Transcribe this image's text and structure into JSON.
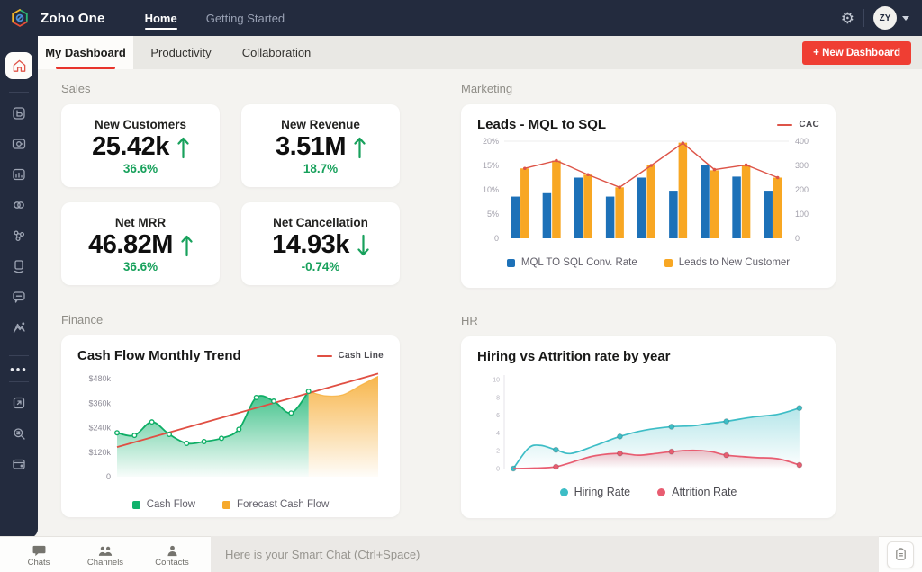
{
  "topbar": {
    "app_title": "Zoho One",
    "nav": [
      {
        "label": "Home",
        "active": true
      },
      {
        "label": "Getting Started",
        "active": false
      }
    ],
    "avatar_initials": "ZY"
  },
  "tabs": {
    "items": [
      {
        "label": "My Dashboard",
        "active": true
      },
      {
        "label": "Productivity",
        "active": false
      },
      {
        "label": "Collaboration",
        "active": false
      }
    ],
    "new_dashboard_label": "+ New Dashboard"
  },
  "sections": {
    "sales": "Sales",
    "marketing": "Marketing",
    "finance": "Finance",
    "hr": "HR"
  },
  "kpis": [
    {
      "title": "New Customers",
      "value": "25.42k",
      "arrow": "up",
      "delta": "36.6%"
    },
    {
      "title": "New Revenue",
      "value": "3.51M",
      "arrow": "up",
      "delta": "18.7%"
    },
    {
      "title": "Net MRR",
      "value": "46.82M",
      "arrow": "up",
      "delta": "36.6%"
    },
    {
      "title": "Net Cancellation",
      "value": "14.93k",
      "arrow": "down",
      "delta": "-0.74%"
    }
  ],
  "chatbar": {
    "tabs": [
      {
        "label": "Chats"
      },
      {
        "label": "Channels"
      },
      {
        "label": "Contacts"
      }
    ],
    "placeholder": "Here is your Smart Chat (Ctrl+Space)"
  },
  "colors": {
    "accent_red": "#ef3e33",
    "kpi_green": "#18a15c",
    "topbar_bg": "#232b3e"
  },
  "chart_data": [
    {
      "type": "bar",
      "title": "Leads - MQL to SQL",
      "x_axis_labels": "none",
      "grid": "top-line-only",
      "legend_position": "bottom",
      "y_left": {
        "min": 0,
        "max": 20,
        "ticks": [
          0,
          5,
          10,
          15,
          20
        ],
        "tick_labels": [
          "0",
          "5%",
          "10%",
          "15%",
          "20%"
        ]
      },
      "y_right": {
        "min": 0,
        "max": 400,
        "ticks": [
          0,
          100,
          200,
          300,
          400
        ],
        "tick_labels": [
          "0",
          "100",
          "200",
          "300",
          "400"
        ]
      },
      "series": [
        {
          "name": "MQL TO SQL Conv. Rate",
          "axis": "left",
          "color": "#1d71b8",
          "values": [
            8.6,
            9.3,
            12.5,
            8.6,
            12.5,
            9.8,
            15.0,
            12.7,
            9.8
          ]
        },
        {
          "name": "Leads to New Customer",
          "axis": "left",
          "color": "#f8a723",
          "values": [
            14.4,
            16.0,
            13.1,
            10.5,
            15.0,
            19.7,
            14.0,
            15.1,
            12.5
          ]
        }
      ],
      "line_series": {
        "name": "CAC",
        "axis": "right",
        "color": "#dd5448",
        "values": [
          288,
          320,
          262,
          210,
          300,
          392,
          283,
          302,
          250
        ]
      }
    },
    {
      "type": "area",
      "title": "Cash Flow Monthly Trend",
      "x_axis_labels": "none",
      "legend_position": "bottom",
      "y_axis": {
        "min": 0,
        "max": 520,
        "ticks": [
          0,
          120,
          240,
          360,
          480
        ],
        "tick_labels": [
          "0",
          "$120k",
          "$240k",
          "$360k",
          "$480k"
        ]
      },
      "total_points": 16,
      "series": [
        {
          "name": "Cash Flow",
          "color": "#10b26c",
          "start_index": 0,
          "values": [
            215,
            202,
            268,
            207,
            163,
            172,
            188,
            232,
            388,
            370,
            312,
            418
          ]
        },
        {
          "name": "Forecast Cash Flow",
          "color": "#f6a92c",
          "start_index": 11,
          "values": [
            418,
            396,
            402,
            448,
            492
          ]
        }
      ],
      "trend_line": {
        "name": "Cash Line",
        "color": "#e04f43",
        "start_value": 145,
        "end_value": 505
      }
    },
    {
      "type": "line",
      "title": "Hiring vs Attrition rate by year",
      "x_axis_labels": "none",
      "legend_position": "bottom",
      "y_axis": {
        "min": 0,
        "max": 10.5,
        "ticks": [
          0,
          2,
          4,
          6,
          8,
          10
        ],
        "tick_labels": [
          "0",
          "2",
          "4",
          "6",
          "8",
          "10"
        ]
      },
      "series": [
        {
          "name": "Hiring Rate",
          "color": "#3dbdc6",
          "markers": [
            [
              0.03,
              0
            ],
            [
              0.17,
              2.1
            ],
            [
              0.38,
              3.6
            ],
            [
              0.55,
              4.7
            ],
            [
              0.73,
              5.3
            ],
            [
              0.97,
              6.8
            ]
          ],
          "path": [
            [
              0.03,
              0
            ],
            [
              0.08,
              2.3
            ],
            [
              0.12,
              2.6
            ],
            [
              0.17,
              2.1
            ],
            [
              0.22,
              1.7
            ],
            [
              0.3,
              2.6
            ],
            [
              0.38,
              3.6
            ],
            [
              0.46,
              4.3
            ],
            [
              0.55,
              4.7
            ],
            [
              0.62,
              4.8
            ],
            [
              0.66,
              5.0
            ],
            [
              0.73,
              5.3
            ],
            [
              0.82,
              5.8
            ],
            [
              0.9,
              6.1
            ],
            [
              0.97,
              6.8
            ]
          ]
        },
        {
          "name": "Attrition Rate",
          "color": "#e85d71",
          "markers": [
            [
              0.17,
              0.2
            ],
            [
              0.38,
              1.7
            ],
            [
              0.55,
              1.9
            ],
            [
              0.73,
              1.5
            ],
            [
              0.97,
              0.4
            ]
          ],
          "path": [
            [
              0.03,
              0
            ],
            [
              0.1,
              0.05
            ],
            [
              0.17,
              0.2
            ],
            [
              0.25,
              1.0
            ],
            [
              0.3,
              1.45
            ],
            [
              0.38,
              1.7
            ],
            [
              0.44,
              1.5
            ],
            [
              0.5,
              1.7
            ],
            [
              0.55,
              1.9
            ],
            [
              0.62,
              2.05
            ],
            [
              0.68,
              1.9
            ],
            [
              0.73,
              1.5
            ],
            [
              0.82,
              1.25
            ],
            [
              0.9,
              1.1
            ],
            [
              0.97,
              0.4
            ]
          ]
        }
      ]
    }
  ]
}
